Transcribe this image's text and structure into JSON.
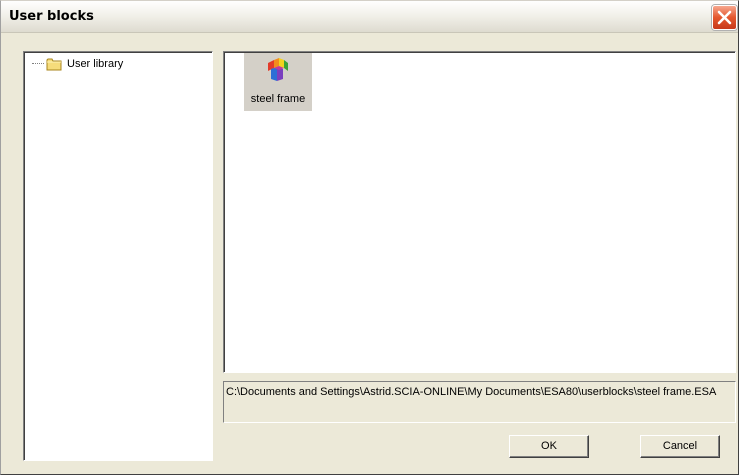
{
  "window": {
    "title": "User blocks"
  },
  "tree": {
    "items": [
      {
        "label": "User library"
      }
    ]
  },
  "files": {
    "items": [
      {
        "label": "steel frame"
      }
    ]
  },
  "path": {
    "value": "C:\\Documents and Settings\\Astrid.SCIA-ONLINE\\My Documents\\ESA80\\userblocks\\steel frame.ESA"
  },
  "buttons": {
    "ok_label": "OK",
    "cancel_label": "Cancel"
  },
  "icons": {
    "close": "close-icon",
    "folder": "folder-icon",
    "block": "steel-frame-block-icon"
  },
  "colors": {
    "dialog_background": "#ece9d8",
    "close_button": "#e4572e",
    "selected_item": "#d4d0c8"
  }
}
